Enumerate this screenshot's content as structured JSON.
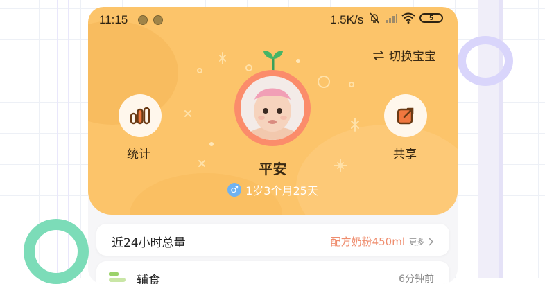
{
  "status_bar": {
    "time": "11:15",
    "network_speed": "1.5K/s",
    "battery_level": "5",
    "icons": [
      "silent-bell-icon",
      "signal-icon",
      "wifi-icon",
      "battery-icon"
    ]
  },
  "header": {
    "switch_baby_label": "切换宝宝",
    "stats_label": "统计",
    "share_label": "共享",
    "baby_name": "平安",
    "gender_symbol": "♂",
    "age": "1岁3个月25天"
  },
  "summary_card": {
    "title": "近24小时总量",
    "value": "配方奶粉450ml",
    "more_label": "更多"
  },
  "feeding_card": {
    "title": "辅食",
    "time": "6分钟前"
  },
  "colors": {
    "header_bg": "#fcc46a",
    "avatar_ring": "#fb8c6b",
    "accent_value": "#ef8d6e",
    "gender_blue": "#6fb2f1",
    "deco_green": "#7cdcb8",
    "deco_purple": "#d9d5fb"
  }
}
